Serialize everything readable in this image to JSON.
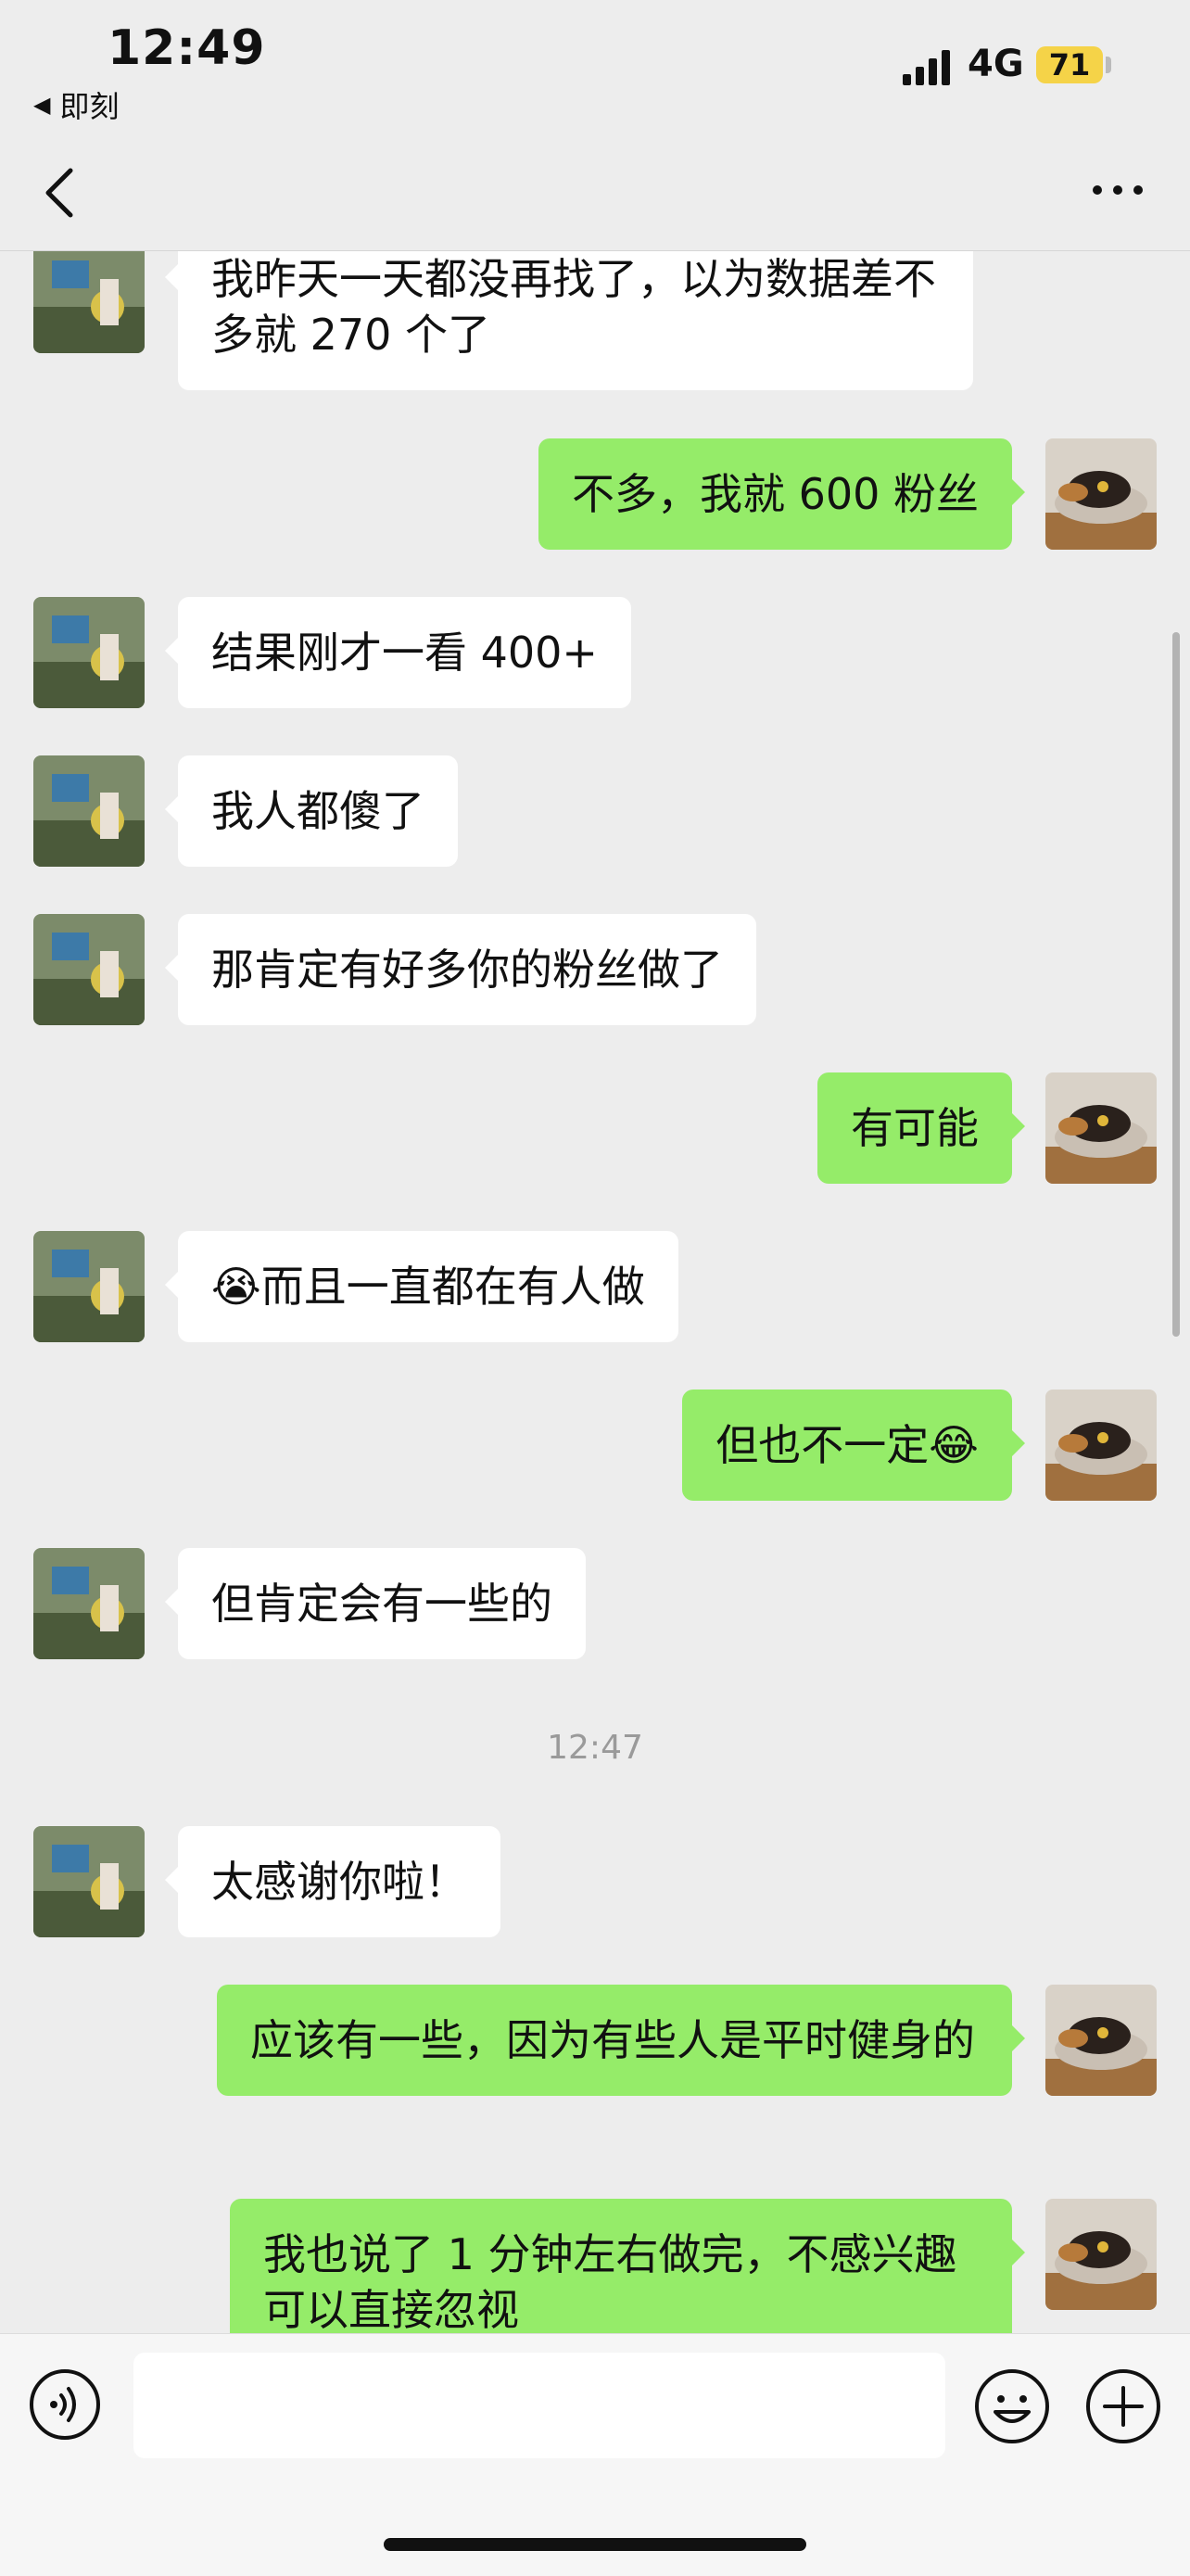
{
  "status": {
    "time": "12:49",
    "back_app": "即刻",
    "network": "4G",
    "battery": "71"
  },
  "colors": {
    "background": "#ededed",
    "incoming_bubble": "#ffffff",
    "outgoing_bubble": "#95ec69",
    "battery": "#f5d348"
  },
  "nav": {
    "back_icon": "chevron-left-icon",
    "more_icon": "more-dots-icon"
  },
  "messages": [
    {
      "from": "other",
      "text": "我昨天一天都没再找了，以为数据差不多就 270 个了"
    },
    {
      "from": "me",
      "text": "不多，我就 600 粉丝"
    },
    {
      "from": "other",
      "text": "结果刚才一看 400+"
    },
    {
      "from": "other",
      "text": "我人都傻了"
    },
    {
      "from": "other",
      "text": "那肯定有好多你的粉丝做了"
    },
    {
      "from": "me",
      "text": "有可能"
    },
    {
      "from": "other",
      "text": "😭而且一直都在有人做"
    },
    {
      "from": "me",
      "text": "但也不一定😂"
    },
    {
      "from": "other",
      "text": "但肯定会有一些的"
    },
    {
      "from": "other",
      "text": "太感谢你啦！"
    },
    {
      "from": "me",
      "text": "应该有一些，因为有些人是平时健身的"
    },
    {
      "from": "me",
      "text": "我也说了 1 分钟左右做完，不感兴趣可以直接忽视"
    }
  ],
  "timestamp": "12:47",
  "input": {
    "value": "",
    "voice_icon": "voice-icon",
    "emoji_icon": "emoji-icon",
    "plus_icon": "plus-icon"
  }
}
